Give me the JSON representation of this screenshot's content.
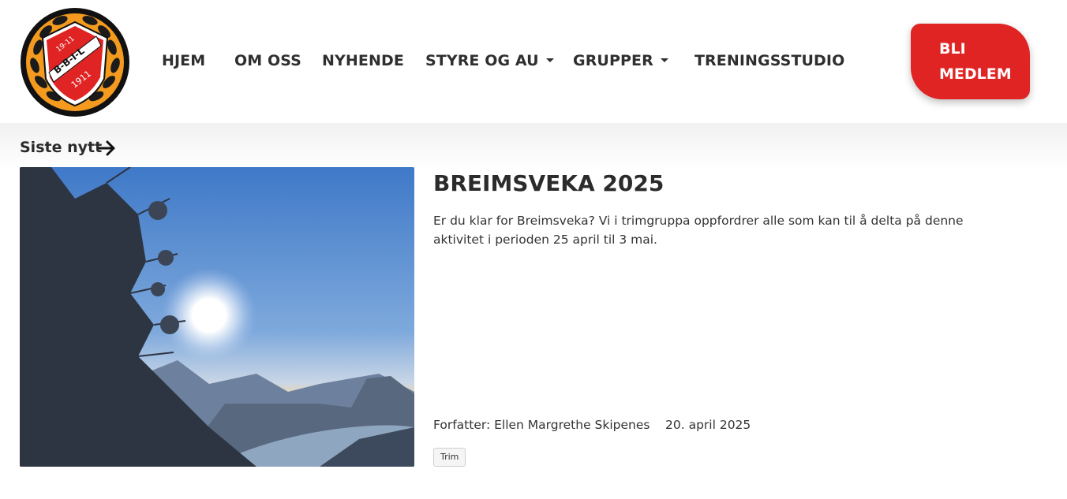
{
  "logo": {
    "icon": "club-crest-icon",
    "text_top": "19-11",
    "text_middle": "B-B-I-L",
    "text_bottom": "1911"
  },
  "nav": {
    "items": [
      {
        "label": "HJEM"
      },
      {
        "label": "OM OSS"
      },
      {
        "label": "NYHENDE"
      },
      {
        "label": "STYRE OG AU",
        "dropdown": true
      },
      {
        "label": "GRUPPER",
        "dropdown": true
      },
      {
        "label": "TRENINGSSTUDIO"
      }
    ],
    "cta_label_line1": "BLI",
    "cta_label_line2": "MEDLEM"
  },
  "section": {
    "title": "Siste nytt",
    "arrow_icon": "arrow-right-icon"
  },
  "news": {
    "title": "BREIMSVEKA 2025",
    "excerpt": "Er du klar for Breimsveka? Vi i trimgruppa oppfordrer alle som kan til å delta på denne aktivitet i perioden 25 april til 3 mai.",
    "author": "Forfatter: Ellen Margrethe Skipenes",
    "date": "20. april 2025",
    "tag": "Trim",
    "image_icon": "mountain-lake-photo"
  },
  "colors": {
    "accent": "#e02424",
    "crest_orange": "#f39a1f",
    "text": "#2b2b2b"
  }
}
